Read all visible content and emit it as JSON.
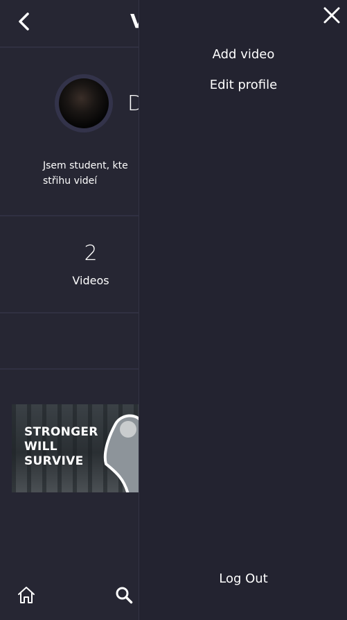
{
  "header": {
    "title_visible": "V"
  },
  "profile": {
    "name_visible": "D",
    "bio": "Jsem  student,  kte\nstřihu videí"
  },
  "stats": {
    "videos_count": "2",
    "videos_label": "Videos"
  },
  "videos": [
    {
      "thumbnail_text": "STRONGER\nWILL\nSURVIVE"
    }
  ],
  "drawer": {
    "items": [
      {
        "label": "Add video"
      },
      {
        "label": "Edit profile"
      }
    ],
    "logout_label": "Log Out"
  },
  "icons": {
    "back": "chevron-left-icon",
    "close": "close-icon",
    "home": "home-icon",
    "search": "search-icon"
  },
  "colors": {
    "background": "#262633",
    "drawer_background": "#232330",
    "separator": "#303042",
    "text": "#ffffff"
  }
}
